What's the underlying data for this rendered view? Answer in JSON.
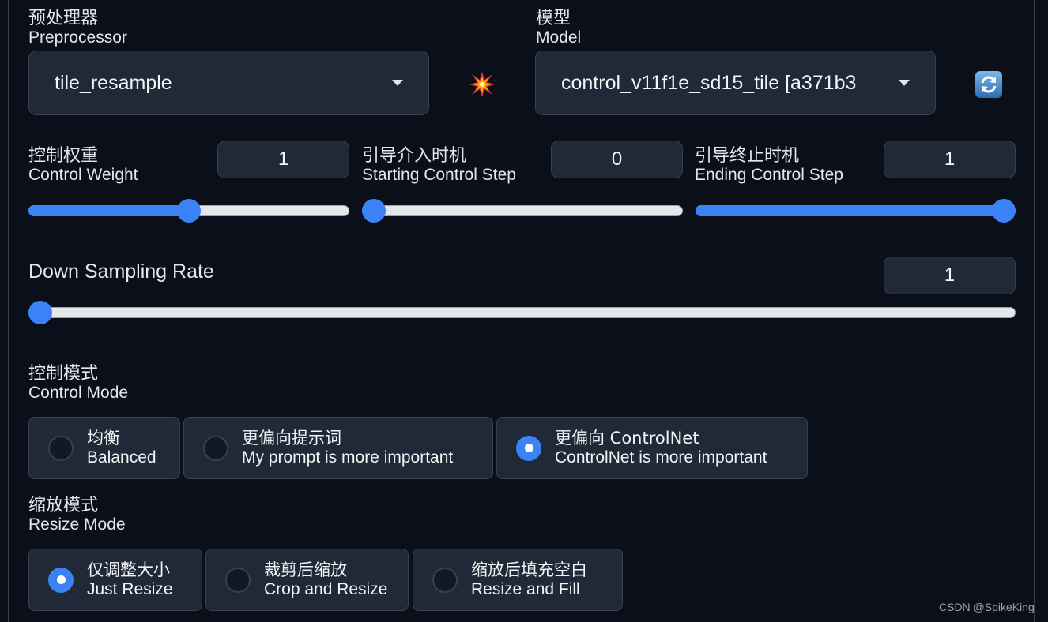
{
  "preprocessor": {
    "label_zh": "预处理器",
    "label_en": "Preprocessor",
    "value": "tile_resample"
  },
  "model": {
    "label_zh": "模型",
    "label_en": "Model",
    "value": "control_v11f1e_sd15_tile [a371b3"
  },
  "icons": {
    "run_preprocessor": "burst-icon",
    "refresh_models": "refresh-icon"
  },
  "control_weight": {
    "label_zh": "控制权重",
    "label_en": "Control Weight",
    "value": "1",
    "fraction": 0.5
  },
  "starting_control_step": {
    "label_zh": "引导介入时机",
    "label_en": "Starting Control Step",
    "value": "0",
    "fraction": 0.0
  },
  "ending_control_step": {
    "label_zh": "引导终止时机",
    "label_en": "Ending Control Step",
    "value": "1",
    "fraction": 1.0
  },
  "down_sampling_rate": {
    "label": "Down Sampling Rate",
    "value": "1",
    "fraction": 0.0
  },
  "control_mode": {
    "label_zh": "控制模式",
    "label_en": "Control Mode",
    "options": [
      {
        "zh": "均衡",
        "en": "Balanced",
        "selected": false
      },
      {
        "zh": "更偏向提示词",
        "en": "My prompt is more important",
        "selected": false
      },
      {
        "zh": "更偏向 ControlNet",
        "en": "ControlNet is more important",
        "selected": true
      }
    ]
  },
  "resize_mode": {
    "label_zh": "缩放模式",
    "label_en": "Resize Mode",
    "options": [
      {
        "zh": "仅调整大小",
        "en": "Just Resize",
        "selected": true
      },
      {
        "zh": "裁剪后缩放",
        "en": "Crop and Resize",
        "selected": false
      },
      {
        "zh": "缩放后填充空白",
        "en": "Resize and Fill",
        "selected": false
      }
    ]
  },
  "watermark": "CSDN @SpikeKing",
  "colors": {
    "background": "#0b0f19",
    "panel": "#1f2937",
    "border": "#374151",
    "accent": "#3b82f6",
    "track": "#e5e7eb"
  }
}
